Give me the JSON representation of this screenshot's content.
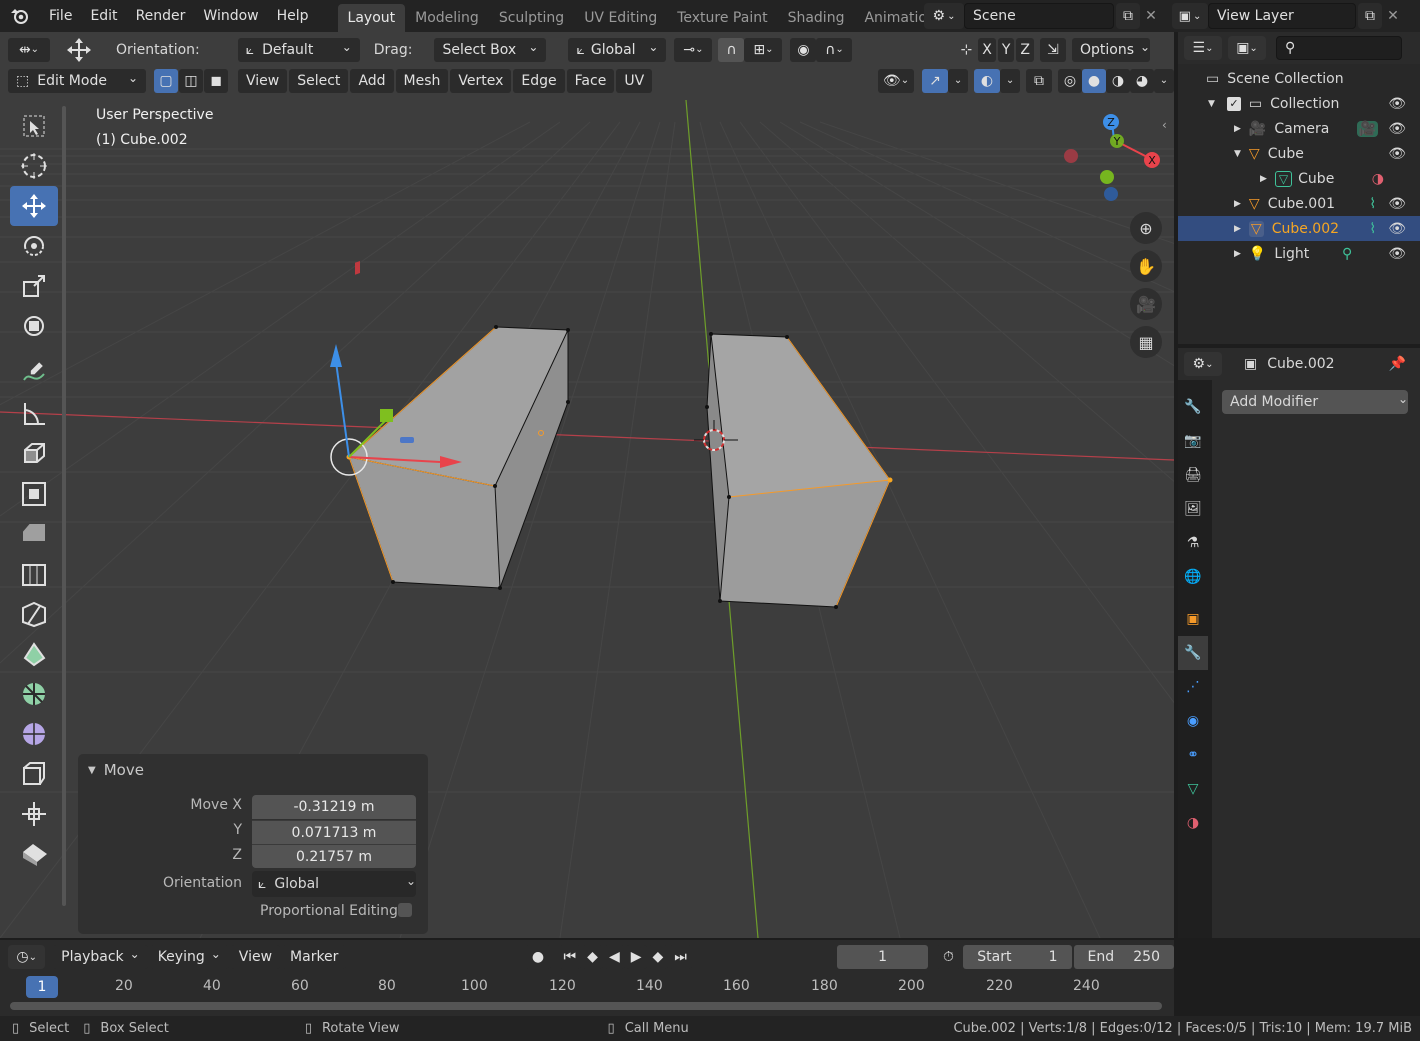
{
  "menus": [
    "File",
    "Edit",
    "Render",
    "Window",
    "Help"
  ],
  "workspaces": [
    {
      "label": "Layout",
      "active": true
    },
    {
      "label": "Modeling"
    },
    {
      "label": "Sculpting"
    },
    {
      "label": "UV Editing"
    },
    {
      "label": "Texture Paint"
    },
    {
      "label": "Shading"
    },
    {
      "label": "Animation"
    }
  ],
  "scene": {
    "name": "Scene",
    "view_layer": "View Layer"
  },
  "tool_settings": {
    "orientation_label": "Orientation:",
    "orientation_value": "Default",
    "drag_label": "Drag:",
    "drag_value": "Select Box",
    "transform_orientation": "Global",
    "axes": [
      "X",
      "Y",
      "Z"
    ],
    "options_label": "Options"
  },
  "viewport_header": {
    "mode": "Edit Mode",
    "menus": [
      "View",
      "Select",
      "Add",
      "Mesh",
      "Vertex",
      "Edge",
      "Face",
      "UV"
    ]
  },
  "viewport_overlay": {
    "view_name": "User Perspective",
    "object_info": "(1) Cube.002"
  },
  "gizmo_axes": {
    "x": "X",
    "y": "Y",
    "z": "Z"
  },
  "tools": [
    "select-box-tool",
    "cursor-tool",
    "move-tool",
    "rotate-tool",
    "scale-tool",
    "transform-tool",
    "annotate-tool",
    "measure-tool",
    "extrude-tool",
    "inset-tool",
    "bevel-tool",
    "loop-cut-tool",
    "knife-tool",
    "poly-build-tool",
    "spin-tool",
    "smooth-tool",
    "edge-slide-tool",
    "shrink-fatten-tool",
    "shear-tool"
  ],
  "outliner": {
    "root": "Scene Collection",
    "items": [
      {
        "label": "Collection",
        "level": 1,
        "icon": "collection-icon"
      },
      {
        "label": "Camera",
        "level": 2,
        "icon": "camera-icon"
      },
      {
        "label": "Cube",
        "level": 2,
        "icon": "mesh-object-icon"
      },
      {
        "label": "Cube",
        "level": 3,
        "icon": "mesh-data-icon"
      },
      {
        "label": "Cube.001",
        "level": 2,
        "icon": "mesh-object-icon"
      },
      {
        "label": "Cube.002",
        "level": 2,
        "icon": "mesh-object-icon",
        "selected": true
      },
      {
        "label": "Light",
        "level": 2,
        "icon": "light-icon"
      }
    ]
  },
  "properties": {
    "object_name": "Cube.002",
    "add_modifier_label": "Add Modifier"
  },
  "operator_panel": {
    "title": "Move",
    "move_x_label": "Move X",
    "move_x": "-0.31219 m",
    "y_label": "Y",
    "y": "0.071713 m",
    "z_label": "Z",
    "z": "0.21757 m",
    "orientation_label": "Orientation",
    "orientation": "Global",
    "proportional_label": "Proportional Editing"
  },
  "timeline": {
    "menus": [
      "Playback",
      "Keying",
      "View",
      "Marker"
    ],
    "current_frame": "1",
    "start_label": "Start",
    "start": "1",
    "end_label": "End",
    "end": "250",
    "ruler": [
      "1",
      "20",
      "40",
      "60",
      "80",
      "100",
      "120",
      "140",
      "160",
      "180",
      "200",
      "220",
      "240"
    ]
  },
  "statusbar": {
    "select": "Select",
    "box_select": "Box Select",
    "rotate_view": "Rotate View",
    "call_menu": "Call Menu",
    "stats": "Cube.002 | Verts:1/8 | Edges:0/12 | Faces:0/5 | Tris:10 | Mem: 19.7 MiB"
  },
  "colors": {
    "accent": "#4772b3",
    "selected_object": "#f5a623",
    "axis_x": "#e8434b",
    "axis_y": "#7fbf1f",
    "axis_z": "#3d8fe8"
  }
}
